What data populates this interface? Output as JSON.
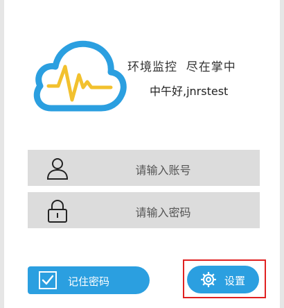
{
  "header": {
    "slogan": "环境监控  尽在掌中",
    "greeting": "中午好,jnrstest"
  },
  "form": {
    "username_placeholder": "请输入账号",
    "password_placeholder": "请输入密码"
  },
  "actions": {
    "remember_label": "记住密码",
    "remember_checked": true,
    "settings_label": "设置"
  },
  "colors": {
    "cloud": "#2b9fe0",
    "pulse": "#f2c12e",
    "button": "#2b9fe0",
    "field": "#dcdcdc",
    "highlight": "#e02020"
  },
  "icons": {
    "logo": "cloud-pulse-icon",
    "username": "person-icon",
    "password": "lock-icon",
    "remember": "checkbox-icon",
    "settings": "gear-icon"
  }
}
